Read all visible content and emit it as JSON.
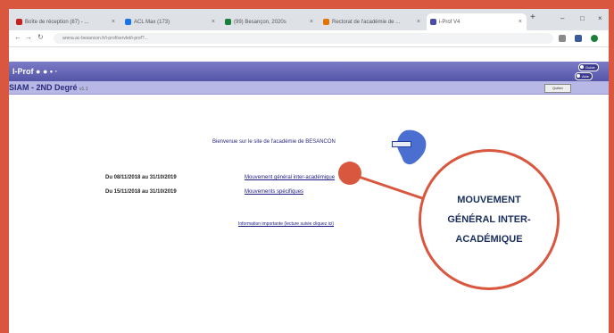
{
  "browser": {
    "tabs": [
      {
        "label": "Boîte de réception (87) - ...",
        "color": "#c5221f"
      },
      {
        "label": "ACL Max (173)",
        "color": "#1a73e8"
      },
      {
        "label": "(99) Besançon, 2020s",
        "color": "#188038"
      },
      {
        "label": "Rectorat de l'académie de ...",
        "color": "#e37400"
      },
      {
        "label": "i-Prof V4",
        "color": "#4a4aa8"
      }
    ],
    "new_tab": "+",
    "window_controls": [
      "–",
      "□",
      "×"
    ],
    "url": "arena.ac-besancon.fr/i-prof/servlet/i-prof?..."
  },
  "app": {
    "name": "I-Prof",
    "dots": "● ● • ·",
    "header_buttons": [
      "Guide",
      "Aide"
    ],
    "subtitle": "SIAM - 2ND Degré",
    "subtitle_small": "v1.1",
    "quit_label": "Quitter"
  },
  "content": {
    "welcome": "Bienvenue sur le site de l'académie de BESANCON",
    "rows": [
      {
        "period": "Du 08/11/2018 au 31/10/2019",
        "link": "Mouvement général inter-académique"
      },
      {
        "period": "Du 15/11/2018 au 31/10/2019",
        "link": "Mouvements spécifiques"
      }
    ],
    "info_link": "Information importante (lecture suivie cliquez ici)"
  },
  "callout": {
    "lines": [
      "MOUVEMENT",
      "GÉNÉRAL INTER-",
      "ACADÉMIQUE"
    ],
    "color": "#d9573f"
  }
}
